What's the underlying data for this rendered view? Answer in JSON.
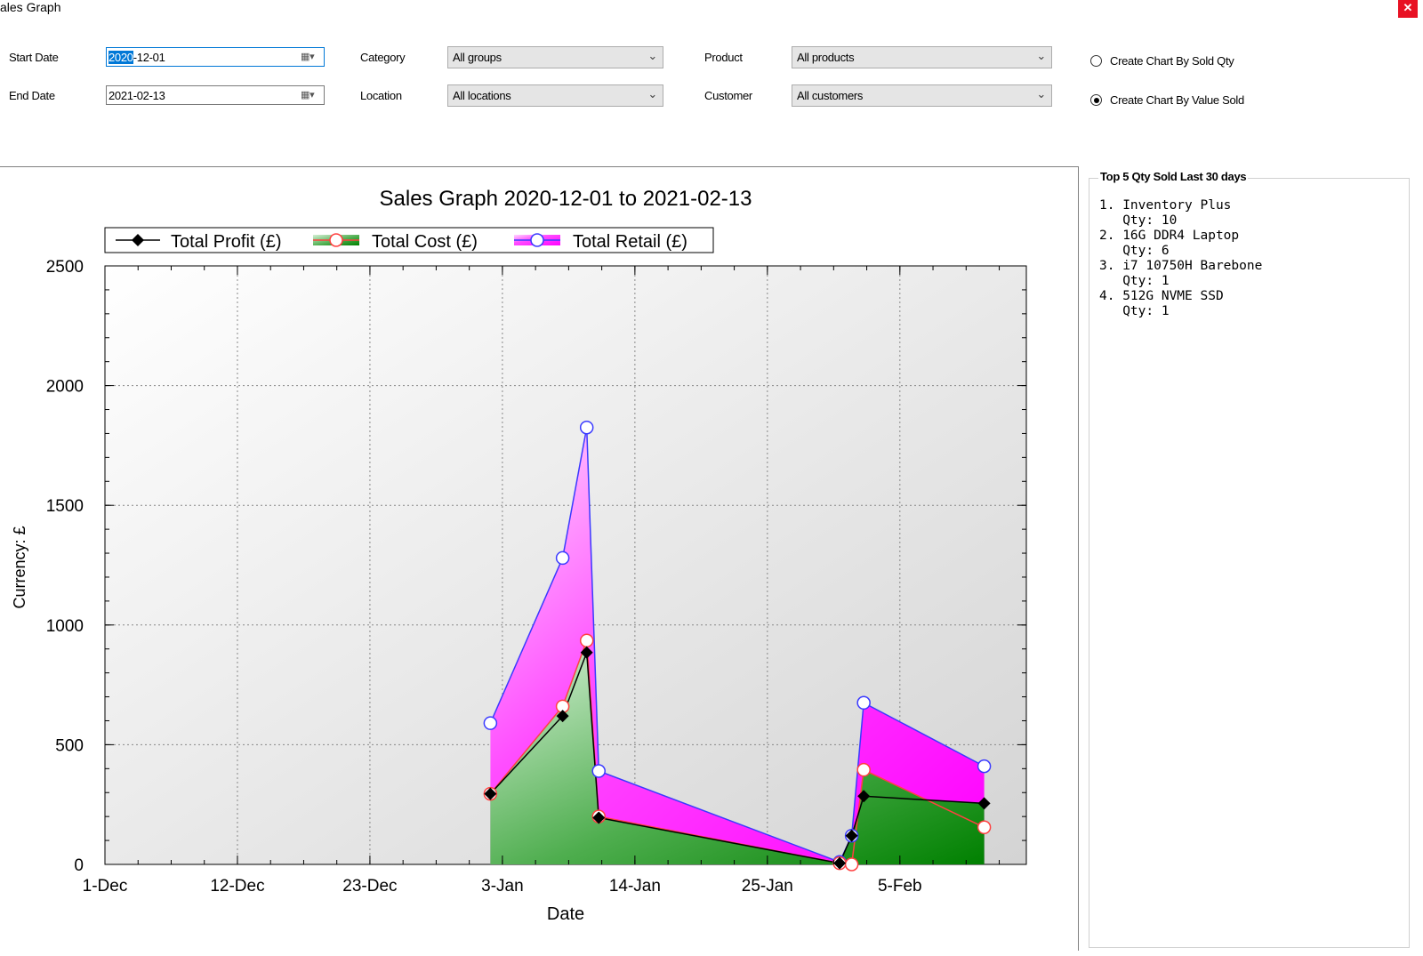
{
  "window": {
    "title": "ales Graph",
    "close_glyph": "✕"
  },
  "filters": {
    "start_date_label": "Start Date",
    "start_date_value": "2020-12-01",
    "end_date_label": "End Date",
    "end_date_value": "2021-02-13",
    "category_label": "Category",
    "category_value": "All groups",
    "location_label": "Location",
    "location_value": "All locations",
    "product_label": "Product",
    "product_value": "All products",
    "customer_label": "Customer",
    "customer_value": "All customers",
    "calendar_icon": "calendar-icon",
    "dropdown_icon": "chevron-down-icon"
  },
  "options": {
    "by_qty_label": "Create Chart By Sold Qty",
    "by_value_label": "Create Chart By Value Sold",
    "selected": "by_value"
  },
  "top5": {
    "title": "Top 5 Qty Sold Last 30 days",
    "items": [
      {
        "rank": "1.",
        "name": "Inventory Plus",
        "qty": "Qty: 10"
      },
      {
        "rank": "2.",
        "name": "16G DDR4 Laptop",
        "qty": "Qty: 6"
      },
      {
        "rank": "3.",
        "name": "i7 10750H Barebone",
        "qty": "Qty: 1"
      },
      {
        "rank": "4.",
        "name": "512G NVME SSD",
        "qty": "Qty: 1"
      }
    ]
  },
  "chart_data": {
    "type": "area",
    "title": "Sales Graph 2020-12-01 to 2021-02-13",
    "xlabel": "Date",
    "ylabel": "Currency: £",
    "x_ticks": [
      "1-Dec",
      "12-Dec",
      "23-Dec",
      "3-Jan",
      "14-Jan",
      "25-Jan",
      "5-Feb"
    ],
    "y_ticks": [
      0,
      500,
      1000,
      1500,
      2000,
      2500
    ],
    "ylim": [
      0,
      2500
    ],
    "grid": true,
    "legend_position": "top",
    "x": [
      "2021-01-02",
      "2021-01-08",
      "2021-01-10",
      "2021-01-11",
      "2021-01-31",
      "2021-02-01",
      "2021-02-02",
      "2021-02-12"
    ],
    "series": [
      {
        "name": "Total Profit (£)",
        "values": [
          295,
          620,
          885,
          195,
          5,
          120,
          285,
          255
        ],
        "color": "#000000",
        "marker": "diamond"
      },
      {
        "name": "Total Cost (£)",
        "values": [
          295,
          660,
          935,
          200,
          5,
          0,
          395,
          155
        ],
        "color": "#ff4040",
        "marker": "circle"
      },
      {
        "name": "Total Retail (£)",
        "values": [
          590,
          1280,
          1825,
          390,
          10,
          120,
          675,
          410
        ],
        "color": "#3a3aff",
        "marker": "circle"
      }
    ]
  }
}
